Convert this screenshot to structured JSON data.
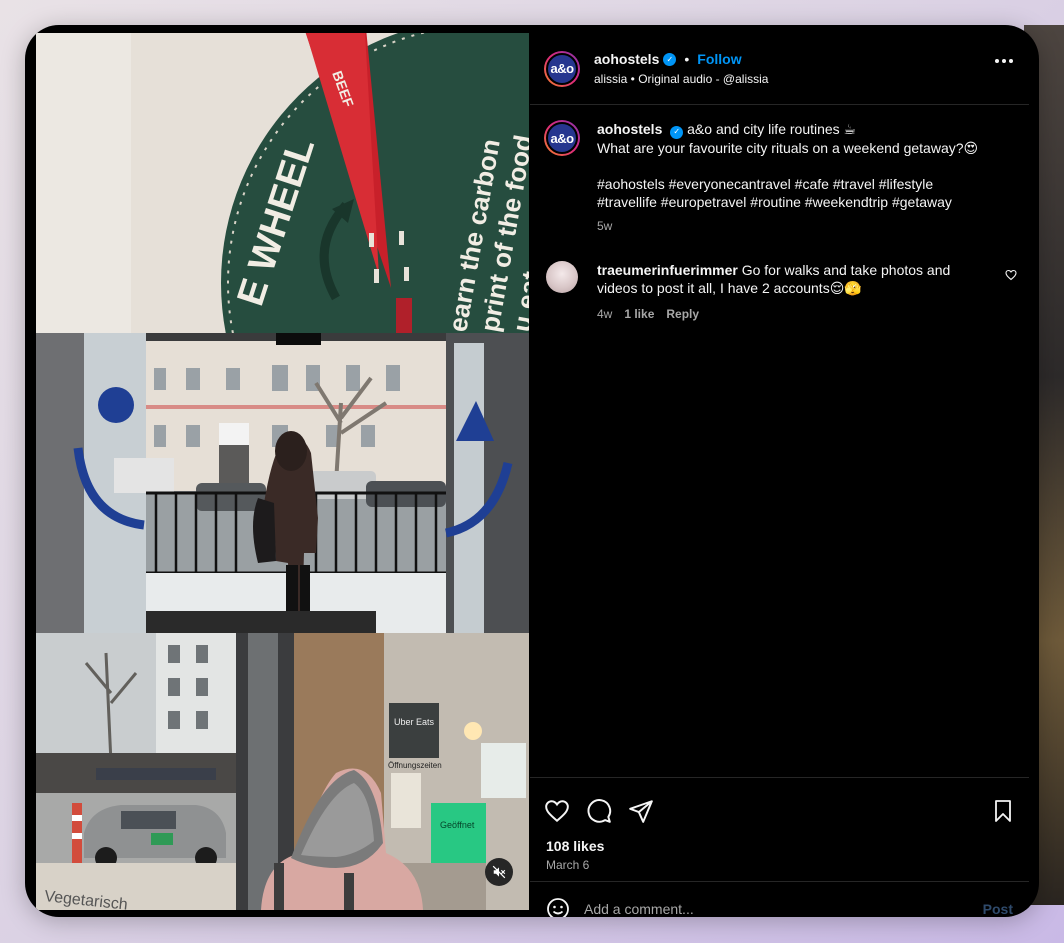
{
  "author": {
    "username": "aohostels",
    "avatar_text": "a&o",
    "follow_label": "Follow",
    "separator": "•",
    "subline": "alissia • Original audio - @alissia"
  },
  "caption": {
    "username": "aohostels",
    "line1": "a&o and city life routines ☕",
    "line2": "What are your favourite city rituals on a weekend getaway?😍",
    "hashtags_line1": "#aohostels #everyonecantravel #cafe #travel #lifestyle",
    "hashtags_line2": "#travellife #europetravel #routine #weekendtrip #getaway",
    "age": "5w"
  },
  "comments": [
    {
      "username": "traeumerinfuerimmer",
      "text": "Go for walks and take photos and videos to post it all, I have 2 accounts😌🫣",
      "age": "4w",
      "likes": "1 like",
      "reply_label": "Reply"
    }
  ],
  "stats": {
    "likes": "108 likes",
    "date": "March 6"
  },
  "comment_box": {
    "placeholder": "Add a comment...",
    "post_label": "Post"
  },
  "media": {
    "wheel_title": "E WHEEL",
    "wheel_segment": "BEEF",
    "wheel_text": [
      "earn the carbon",
      "print of the food",
      "u eat"
    ],
    "storefront_sign": "Uber Eats",
    "door_sticker": "Geöffnet",
    "window_text": "Öffnungszeiten",
    "floor_text": "Vegetarisch"
  },
  "colors": {
    "accent": "#0095f6",
    "panel_bg": "#000000",
    "muted": "#a8a8a8",
    "wheel_green": "#264d3f",
    "wheel_red": "#c8202a"
  },
  "icons": [
    "verified-badge-icon",
    "more-options-icon",
    "heart-icon",
    "comment-icon",
    "share-icon",
    "bookmark-icon",
    "emoji-icon",
    "mute-icon"
  ]
}
